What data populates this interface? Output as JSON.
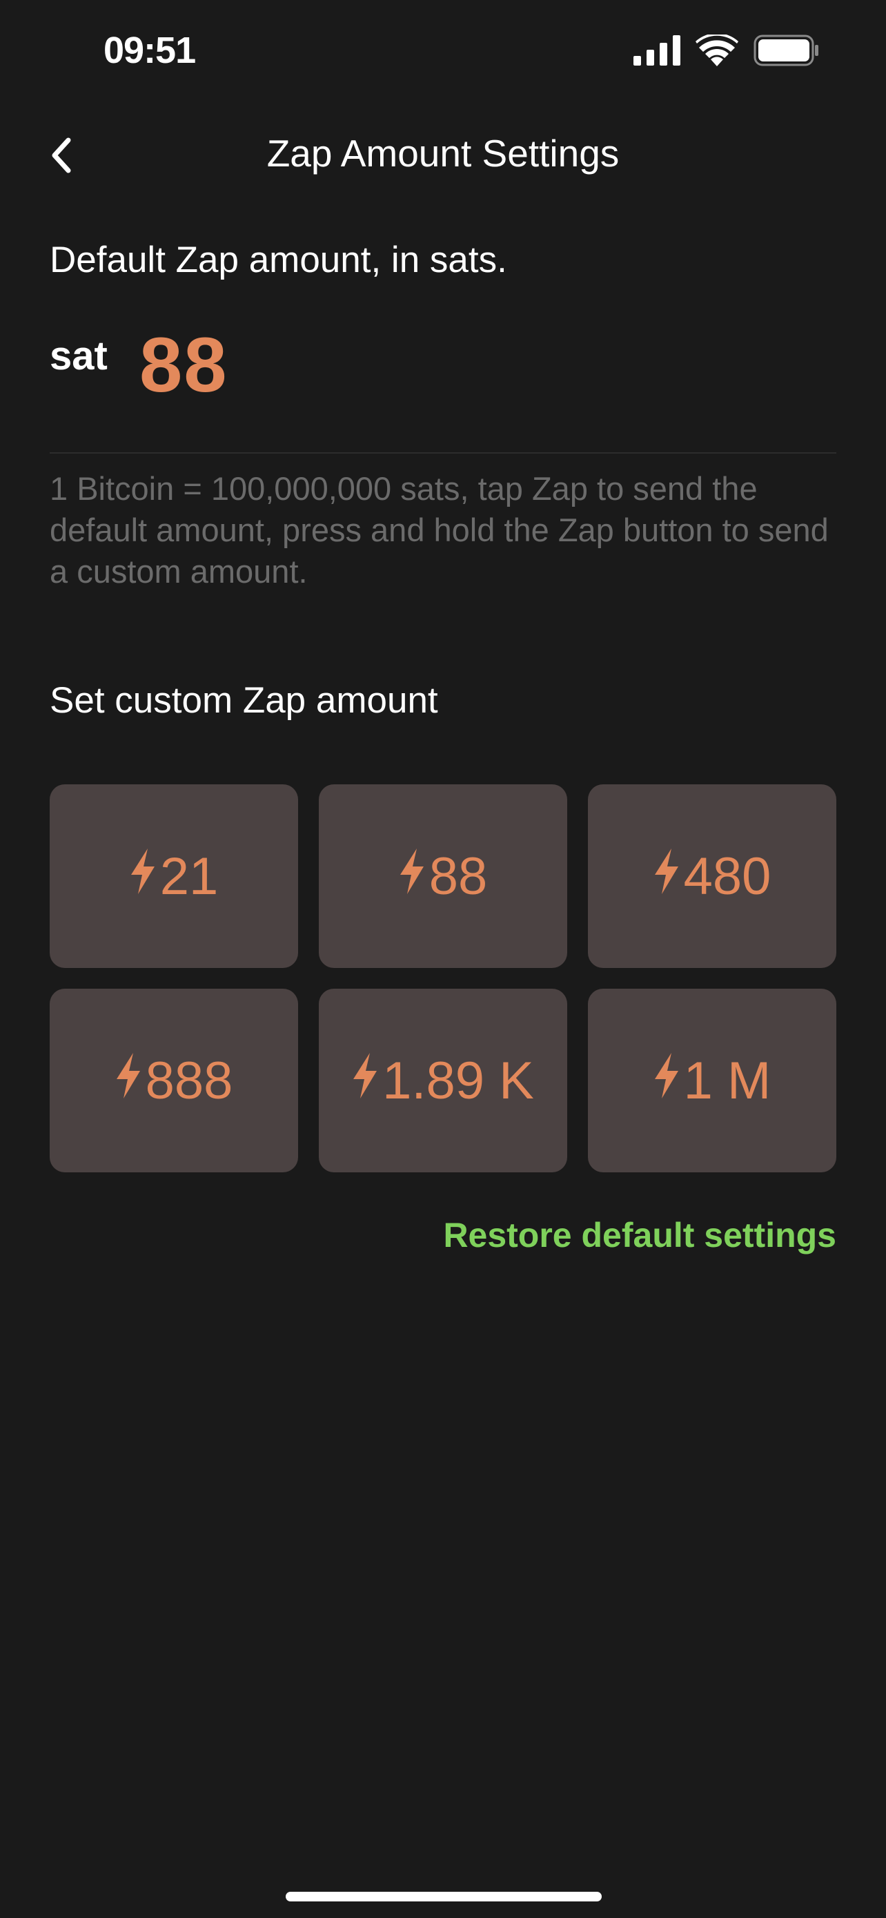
{
  "status_bar": {
    "time": "09:51"
  },
  "nav": {
    "title": "Zap Amount Settings"
  },
  "default_section": {
    "label": "Default Zap amount, in sats.",
    "unit": "sat",
    "value": "88",
    "hint": "1 Bitcoin = 100,000,000 sats, tap Zap to send the default amount, press and hold the Zap button to send a custom amount."
  },
  "custom_section": {
    "label": "Set custom Zap amount",
    "presets": [
      {
        "label": "21"
      },
      {
        "label": "88"
      },
      {
        "label": "480"
      },
      {
        "label": "888"
      },
      {
        "label": "1.89 K"
      },
      {
        "label": "1 M"
      }
    ]
  },
  "restore": {
    "label": "Restore default settings"
  },
  "colors": {
    "background": "#1a1a1a",
    "accent_orange": "#e3895b",
    "restore_green": "#7fd15b",
    "preset_bg": "#4b4242",
    "hint_gray": "#6b6b6b"
  },
  "icons": {
    "preset_icon": "lightning-bolt-icon",
    "back_icon": "chevron-left-icon"
  }
}
